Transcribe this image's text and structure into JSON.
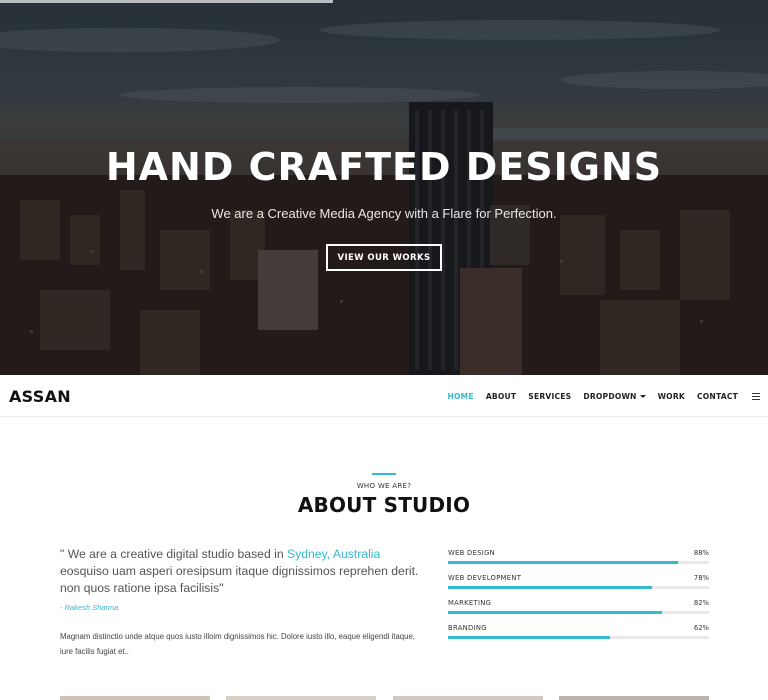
{
  "hero": {
    "title": "HAND CRAFTED DESIGNS",
    "subtitle": "We are a Creative Media Agency with a Flare for Perfection.",
    "button_label": "VIEW OUR WORKS"
  },
  "navbar": {
    "logo": "ASSAN",
    "items": [
      {
        "label": "HOME",
        "active": true
      },
      {
        "label": "ABOUT",
        "active": false
      },
      {
        "label": "SERVICES",
        "active": false
      },
      {
        "label": "DROPDOWN",
        "active": false,
        "has_caret": true
      },
      {
        "label": "WORK",
        "active": false
      },
      {
        "label": "CONTACT",
        "active": false
      }
    ],
    "menu_icon": "list-menu-icon"
  },
  "about": {
    "kicker": "WHO WE ARE?",
    "title": "ABOUT STUDIO",
    "quote_before": "\" We are a creative digital studio based in ",
    "quote_highlight": "Sydney, Australia",
    "quote_after": " eosquiso uam asperi oresipsum itaque dignissimos reprehen derit. non quos ratione ipsa facilisis\"",
    "quote_author": "- Rakesh Sharma",
    "body": "Magnam distinctio unde atque quos iusto illoim dignissimos hic. Dolore iusto illo, eaque eligendi itaque, iure facilis fugiat et.."
  },
  "skills": [
    {
      "name": "WEB DESIGN",
      "percent_label": "88%",
      "value": 88
    },
    {
      "name": "WEB DEVELOPMENT",
      "percent_label": "78%",
      "value": 78
    },
    {
      "name": "MARKETING",
      "percent_label": "82%",
      "value": 82
    },
    {
      "name": "BRANDING",
      "percent_label": "62%",
      "value": 62
    }
  ],
  "colors": {
    "accent": "#33bcd0",
    "text_dark": "#111111",
    "track": "#e9e9e9"
  }
}
